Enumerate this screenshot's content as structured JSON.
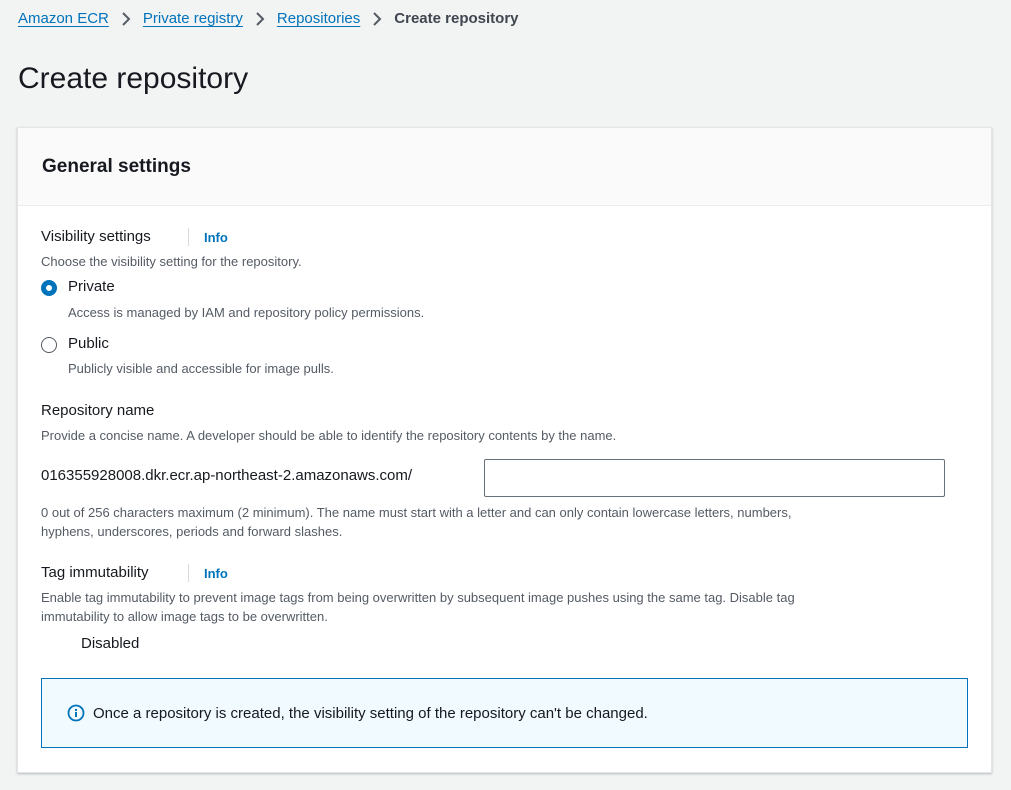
{
  "breadcrumb": {
    "items": [
      "Amazon ECR",
      "Private registry",
      "Repositories"
    ],
    "current": "Create repository"
  },
  "page": {
    "title": "Create repository"
  },
  "general_settings": {
    "title": "General settings",
    "visibility": {
      "label": "Visibility settings",
      "info": "Info",
      "description": "Choose the visibility setting for the repository.",
      "selected": "Private",
      "options": [
        {
          "label": "Private",
          "description": "Access is managed by IAM and repository policy permissions."
        },
        {
          "label": "Public",
          "description": "Publicly visible and accessible for image pulls."
        }
      ]
    },
    "repository_name": {
      "label": "Repository name",
      "description": "Provide a concise name. A developer should be able to identify the repository contents by the name.",
      "prefix": "016355928008.dkr.ecr.ap-northeast-2.amazonaws.com/",
      "value": "",
      "placeholder": "",
      "constraint_line1": "0 out of 256 characters maximum (2 minimum). The name must start with a letter and can only contain lowercase letters, numbers,",
      "constraint_line2": "hyphens, underscores, periods and forward slashes."
    },
    "tag_immutability": {
      "label": "Tag immutability",
      "info": "Info",
      "description_line1": "Enable tag immutability to prevent image tags from being overwritten by subsequent image pushes using the same tag. Disable tag",
      "description_line2": "immutability to allow image tags to be overwritten.",
      "toggle_label": "Disabled",
      "enabled": false
    },
    "alert": {
      "icon": "info-circle-icon",
      "text": "Once a repository is created, the visibility setting of the repository can't be changed."
    }
  },
  "colors": {
    "link": "#0073bb",
    "background": "#f2f3f3",
    "alert_bg": "#f1faff",
    "alert_border": "#0073bb"
  }
}
